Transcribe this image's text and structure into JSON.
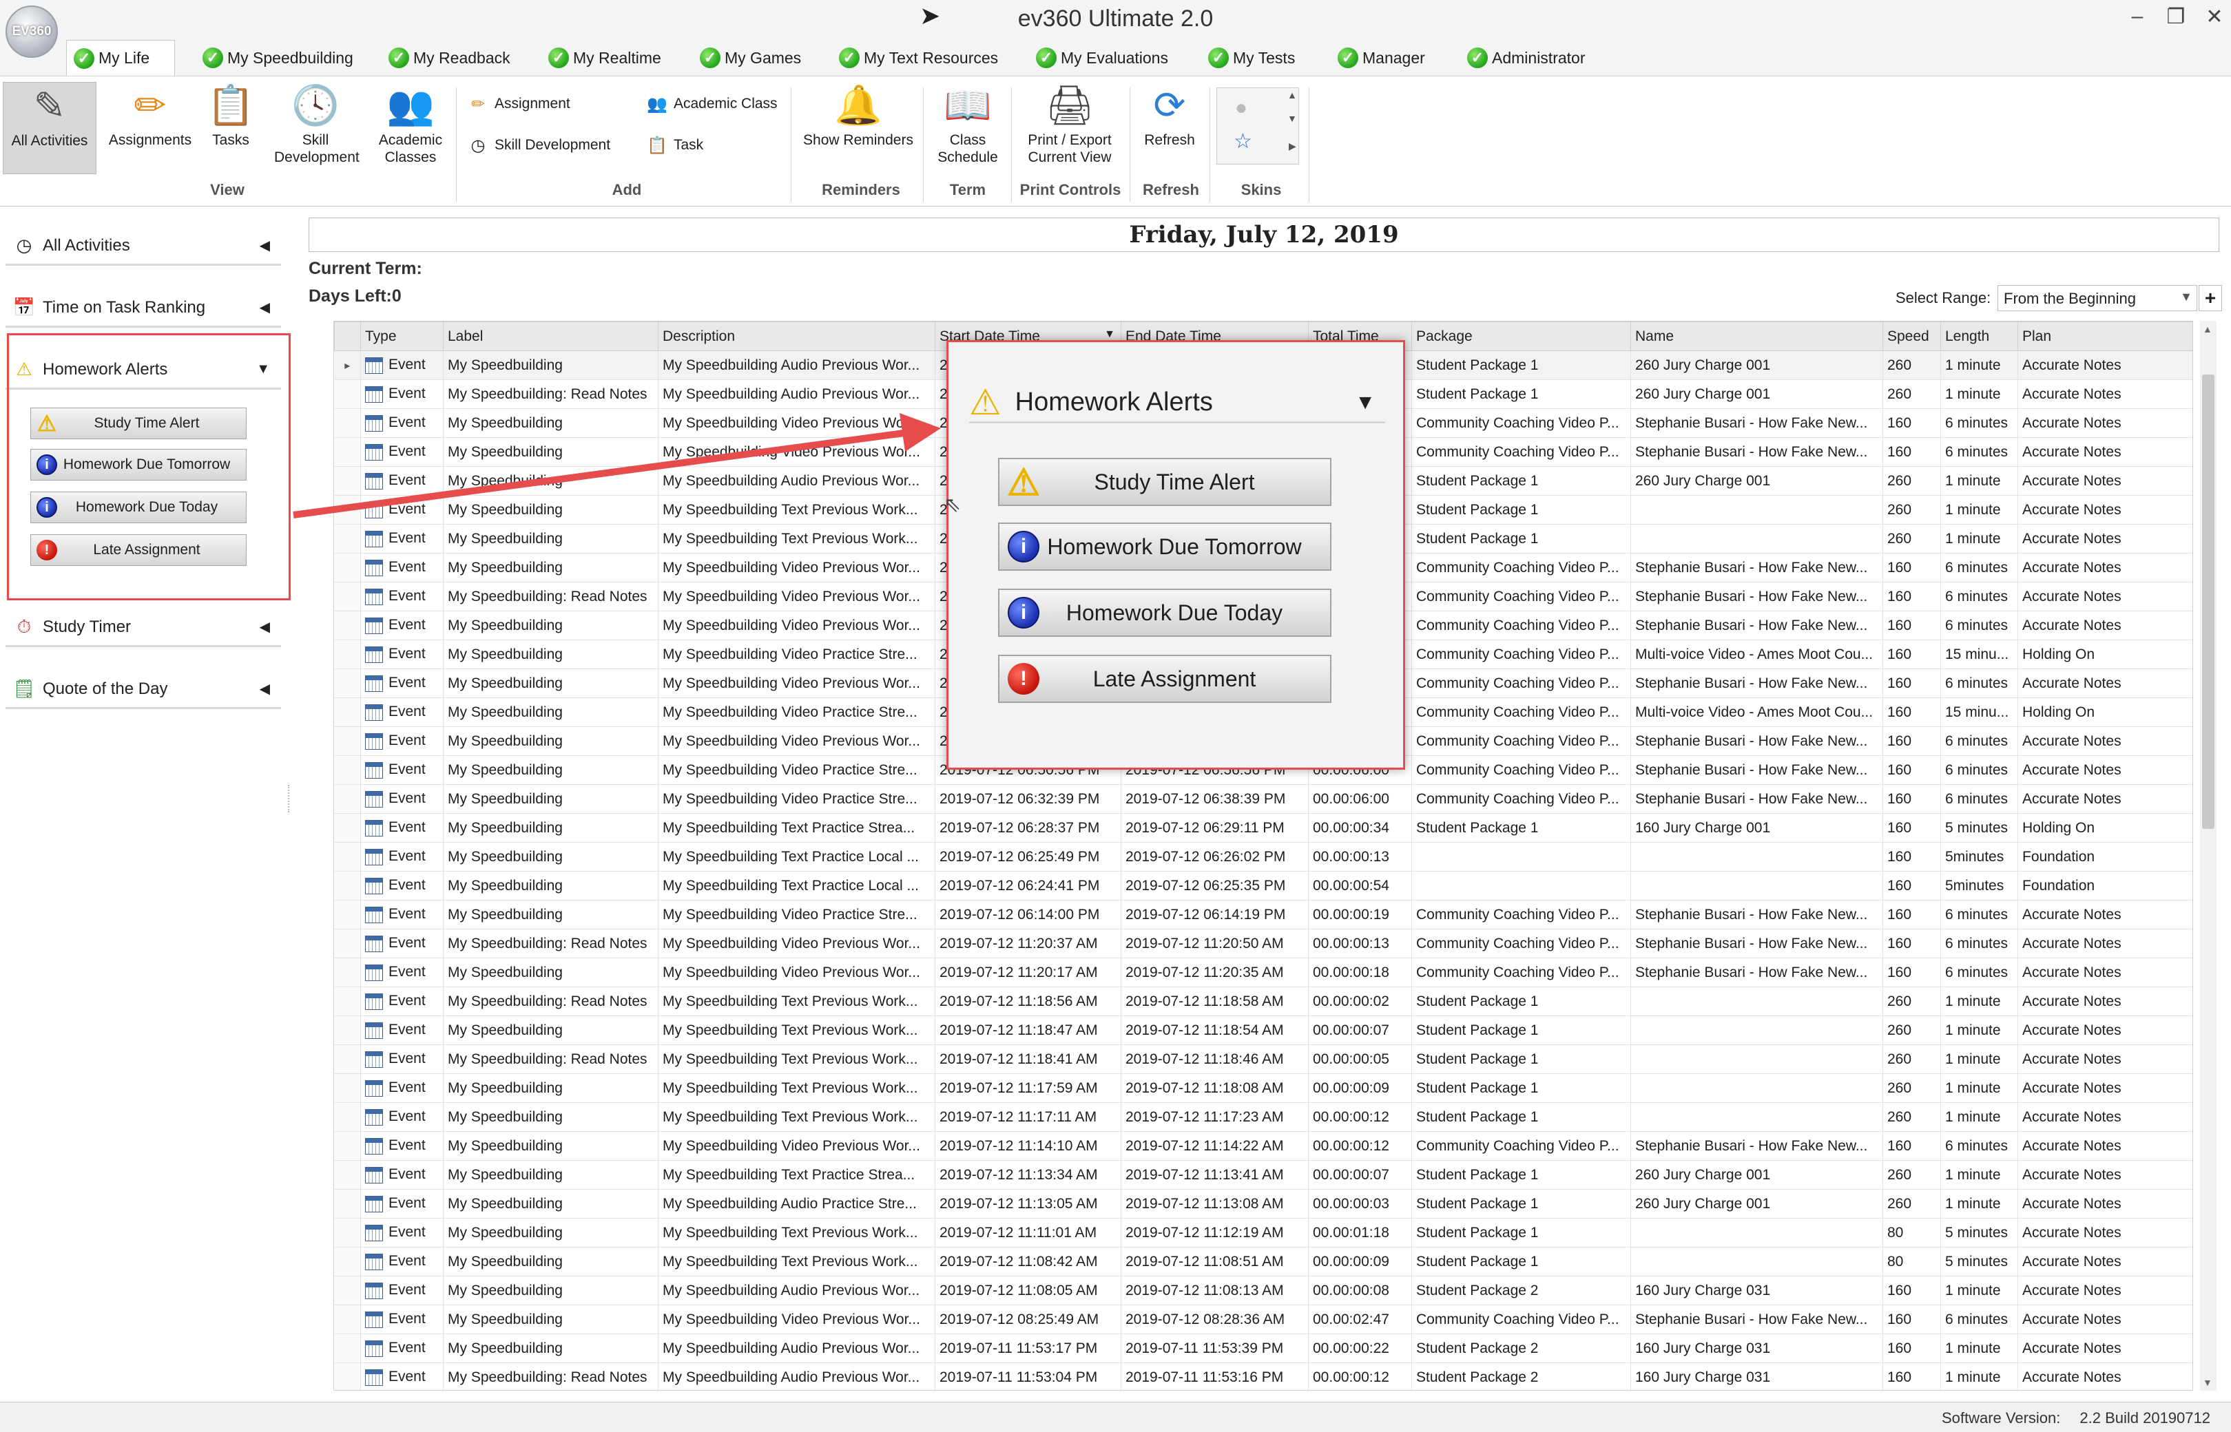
{
  "window": {
    "title": "ev360 Ultimate 2.0",
    "logo_text": "EV360",
    "minimize": "–",
    "maximize": "❐",
    "close": "✕"
  },
  "tabs": [
    {
      "label": "My Life",
      "active": true
    },
    {
      "label": "My Speedbuilding"
    },
    {
      "label": "My Readback"
    },
    {
      "label": "My Realtime"
    },
    {
      "label": "My Games"
    },
    {
      "label": "My Text Resources"
    },
    {
      "label": "My Evaluations"
    },
    {
      "label": "My Tests"
    },
    {
      "label": "Manager"
    },
    {
      "label": "Administrator"
    }
  ],
  "ribbon": {
    "view": {
      "label": "View",
      "all_activities": "All Activities",
      "assignments": "Assignments",
      "tasks": "Tasks",
      "skill_development": "Skill Development",
      "academic_classes": "Academic Classes"
    },
    "add": {
      "label": "Add",
      "assignment": "Assignment",
      "skill_development": "Skill Development",
      "academic_class": "Academic Class",
      "task": "Task"
    },
    "reminders": {
      "label": "Reminders",
      "show_reminders": "Show Reminders"
    },
    "term": {
      "label": "Term",
      "class_schedule": "Class Schedule"
    },
    "print_controls": {
      "label": "Print Controls",
      "print_export": "Print / Export Current View"
    },
    "refresh": {
      "label": "Refresh",
      "refresh": "Refresh"
    },
    "skins": {
      "label": "Skins"
    }
  },
  "sidebar": {
    "all_activities": "All Activities",
    "time_on_task": "Time on Task Ranking",
    "homework_alerts": "Homework Alerts",
    "study_timer": "Study Timer",
    "quote_of_day": "Quote of the Day",
    "alerts": {
      "study_time": "Study Time Alert",
      "due_tomorrow": "Homework Due Tomorrow",
      "due_today": "Homework Due Today",
      "late": "Late Assignment"
    }
  },
  "main": {
    "date": "Friday, July 12, 2019",
    "current_term_label": "Current Term:",
    "days_left_label": "Days Left:0",
    "select_range_label": "Select Range:",
    "select_range_value": "From the Beginning"
  },
  "grid": {
    "columns": [
      "Type",
      "Label",
      "Description",
      "Start Date Time",
      "End Date Time",
      "Total Time",
      "Package",
      "Name",
      "Speed",
      "Length",
      "Plan"
    ],
    "rows": [
      [
        "Event",
        "My Speedbuilding",
        "My Speedbuilding Audio Previous Wor...",
        "2019",
        "",
        "",
        "Student Package 1",
        "260 Jury Charge 001",
        "260",
        "1 minute",
        "Accurate Notes"
      ],
      [
        "Event",
        "My Speedbuilding: Read Notes",
        "My Speedbuilding Audio Previous Wor...",
        "2019",
        "",
        "",
        "Student Package 1",
        "260 Jury Charge 001",
        "260",
        "1 minute",
        "Accurate Notes"
      ],
      [
        "Event",
        "My Speedbuilding",
        "My Speedbuilding Video Previous Wor...",
        "2019",
        "",
        "",
        "Community Coaching Video P...",
        "Stephanie Busari - How Fake New...",
        "160",
        "6 minutes",
        "Accurate Notes"
      ],
      [
        "Event",
        "My Speedbuilding",
        "My Speedbuilding Video Previous Wor...",
        "2019",
        "",
        "",
        "Community Coaching Video P...",
        "Stephanie Busari - How Fake New...",
        "160",
        "6 minutes",
        "Accurate Notes"
      ],
      [
        "Event",
        "My Speedbuilding",
        "My Speedbuilding Audio Previous Wor...",
        "2019",
        "",
        "",
        "Student Package 1",
        "260 Jury Charge 001",
        "260",
        "1 minute",
        "Accurate Notes"
      ],
      [
        "Event",
        "My Speedbuilding",
        "My Speedbuilding Text Previous Work...",
        "2019",
        "",
        "",
        "Student Package 1",
        "",
        "260",
        "1 minute",
        "Accurate Notes"
      ],
      [
        "Event",
        "My Speedbuilding",
        "My Speedbuilding Text Previous Work...",
        "2019",
        "",
        "",
        "Student Package 1",
        "",
        "260",
        "1 minute",
        "Accurate Notes"
      ],
      [
        "Event",
        "My Speedbuilding",
        "My Speedbuilding Video Previous Wor...",
        "2019",
        "",
        "",
        "Community Coaching Video P...",
        "Stephanie Busari - How Fake New...",
        "160",
        "6 minutes",
        "Accurate Notes"
      ],
      [
        "Event",
        "My Speedbuilding: Read Notes",
        "My Speedbuilding Video Previous Wor...",
        "2019",
        "",
        "",
        "Community Coaching Video P...",
        "Stephanie Busari - How Fake New...",
        "160",
        "6 minutes",
        "Accurate Notes"
      ],
      [
        "Event",
        "My Speedbuilding",
        "My Speedbuilding Video Previous Wor...",
        "2019",
        "",
        "",
        "Community Coaching Video P...",
        "Stephanie Busari - How Fake New...",
        "160",
        "6 minutes",
        "Accurate Notes"
      ],
      [
        "Event",
        "My Speedbuilding",
        "My Speedbuilding Video Practice Stre...",
        "2019",
        "",
        "",
        "Community Coaching Video P...",
        "Multi-voice Video - Ames Moot Cou...",
        "160",
        "15 minu...",
        "Holding On"
      ],
      [
        "Event",
        "My Speedbuilding",
        "My Speedbuilding Video Previous Wor...",
        "2019",
        "",
        "",
        "Community Coaching Video P...",
        "Stephanie Busari - How Fake New...",
        "160",
        "6 minutes",
        "Accurate Notes"
      ],
      [
        "Event",
        "My Speedbuilding",
        "My Speedbuilding Video Practice Stre...",
        "2019",
        "",
        "",
        "Community Coaching Video P...",
        "Multi-voice Video - Ames Moot Cou...",
        "160",
        "15 minu...",
        "Holding On"
      ],
      [
        "Event",
        "My Speedbuilding",
        "My Speedbuilding Video Previous Wor...",
        "2019",
        "",
        "",
        "Community Coaching Video P...",
        "Stephanie Busari - How Fake New...",
        "160",
        "6 minutes",
        "Accurate Notes"
      ],
      [
        "Event",
        "My Speedbuilding",
        "My Speedbuilding Video Practice Stre...",
        "2019-07-12 06:50:56 PM",
        "2019-07-12 06:56:56 PM",
        "00.00:06:00",
        "Community Coaching Video P...",
        "Stephanie Busari - How Fake New...",
        "160",
        "6 minutes",
        "Accurate Notes"
      ],
      [
        "Event",
        "My Speedbuilding",
        "My Speedbuilding Video Practice Stre...",
        "2019-07-12 06:32:39 PM",
        "2019-07-12 06:38:39 PM",
        "00.00:06:00",
        "Community Coaching Video P...",
        "Stephanie Busari - How Fake New...",
        "160",
        "6 minutes",
        "Accurate Notes"
      ],
      [
        "Event",
        "My Speedbuilding",
        "My Speedbuilding Text Practice Strea...",
        "2019-07-12 06:28:37 PM",
        "2019-07-12 06:29:11 PM",
        "00.00:00:34",
        "Student Package 1",
        "160 Jury Charge 001",
        "160",
        "5 minutes",
        "Holding On"
      ],
      [
        "Event",
        "My Speedbuilding",
        "My Speedbuilding Text Practice Local ...",
        "2019-07-12 06:25:49 PM",
        "2019-07-12 06:26:02 PM",
        "00.00:00:13",
        "",
        "",
        "160",
        "5minutes",
        "Foundation"
      ],
      [
        "Event",
        "My Speedbuilding",
        "My Speedbuilding Text Practice Local ...",
        "2019-07-12 06:24:41 PM",
        "2019-07-12 06:25:35 PM",
        "00.00:00:54",
        "",
        "",
        "160",
        "5minutes",
        "Foundation"
      ],
      [
        "Event",
        "My Speedbuilding",
        "My Speedbuilding Video Practice Stre...",
        "2019-07-12 06:14:00 PM",
        "2019-07-12 06:14:19 PM",
        "00.00:00:19",
        "Community Coaching Video P...",
        "Stephanie Busari - How Fake New...",
        "160",
        "6 minutes",
        "Accurate Notes"
      ],
      [
        "Event",
        "My Speedbuilding: Read Notes",
        "My Speedbuilding Video Previous Wor...",
        "2019-07-12 11:20:37 AM",
        "2019-07-12 11:20:50 AM",
        "00.00:00:13",
        "Community Coaching Video P...",
        "Stephanie Busari - How Fake New...",
        "160",
        "6 minutes",
        "Accurate Notes"
      ],
      [
        "Event",
        "My Speedbuilding",
        "My Speedbuilding Video Previous Wor...",
        "2019-07-12 11:20:17 AM",
        "2019-07-12 11:20:35 AM",
        "00.00:00:18",
        "Community Coaching Video P...",
        "Stephanie Busari - How Fake New...",
        "160",
        "6 minutes",
        "Accurate Notes"
      ],
      [
        "Event",
        "My Speedbuilding: Read Notes",
        "My Speedbuilding Text Previous Work...",
        "2019-07-12 11:18:56 AM",
        "2019-07-12 11:18:58 AM",
        "00.00:00:02",
        "Student Package 1",
        "",
        "260",
        "1 minute",
        "Accurate Notes"
      ],
      [
        "Event",
        "My Speedbuilding",
        "My Speedbuilding Text Previous Work...",
        "2019-07-12 11:18:47 AM",
        "2019-07-12 11:18:54 AM",
        "00.00:00:07",
        "Student Package 1",
        "",
        "260",
        "1 minute",
        "Accurate Notes"
      ],
      [
        "Event",
        "My Speedbuilding: Read Notes",
        "My Speedbuilding Text Previous Work...",
        "2019-07-12 11:18:41 AM",
        "2019-07-12 11:18:46 AM",
        "00.00:00:05",
        "Student Package 1",
        "",
        "260",
        "1 minute",
        "Accurate Notes"
      ],
      [
        "Event",
        "My Speedbuilding",
        "My Speedbuilding Text Previous Work...",
        "2019-07-12 11:17:59 AM",
        "2019-07-12 11:18:08 AM",
        "00.00:00:09",
        "Student Package 1",
        "",
        "260",
        "1 minute",
        "Accurate Notes"
      ],
      [
        "Event",
        "My Speedbuilding",
        "My Speedbuilding Text Previous Work...",
        "2019-07-12 11:17:11 AM",
        "2019-07-12 11:17:23 AM",
        "00.00:00:12",
        "Student Package 1",
        "",
        "260",
        "1 minute",
        "Accurate Notes"
      ],
      [
        "Event",
        "My Speedbuilding",
        "My Speedbuilding Video Previous Wor...",
        "2019-07-12 11:14:10 AM",
        "2019-07-12 11:14:22 AM",
        "00.00:00:12",
        "Community Coaching Video P...",
        "Stephanie Busari - How Fake New...",
        "160",
        "6 minutes",
        "Accurate Notes"
      ],
      [
        "Event",
        "My Speedbuilding",
        "My Speedbuilding Text Practice Strea...",
        "2019-07-12 11:13:34 AM",
        "2019-07-12 11:13:41 AM",
        "00.00:00:07",
        "Student Package 1",
        "260 Jury Charge 001",
        "260",
        "1 minute",
        "Accurate Notes"
      ],
      [
        "Event",
        "My Speedbuilding",
        "My Speedbuilding Audio Practice Stre...",
        "2019-07-12 11:13:05 AM",
        "2019-07-12 11:13:08 AM",
        "00.00:00:03",
        "Student Package 1",
        "260 Jury Charge 001",
        "260",
        "1 minute",
        "Accurate Notes"
      ],
      [
        "Event",
        "My Speedbuilding",
        "My Speedbuilding Text Previous Work...",
        "2019-07-12 11:11:01 AM",
        "2019-07-12 11:12:19 AM",
        "00.00:01:18",
        "Student Package 1",
        "",
        "80",
        "5 minutes",
        "Accurate Notes"
      ],
      [
        "Event",
        "My Speedbuilding",
        "My Speedbuilding Text Previous Work...",
        "2019-07-12 11:08:42 AM",
        "2019-07-12 11:08:51 AM",
        "00.00:00:09",
        "Student Package 1",
        "",
        "80",
        "5 minutes",
        "Accurate Notes"
      ],
      [
        "Event",
        "My Speedbuilding",
        "My Speedbuilding Audio Previous Wor...",
        "2019-07-12 11:08:05 AM",
        "2019-07-12 11:08:13 AM",
        "00.00:00:08",
        "Student Package 2",
        "160 Jury Charge 031",
        "160",
        "1 minute",
        "Accurate Notes"
      ],
      [
        "Event",
        "My Speedbuilding",
        "My Speedbuilding Video Previous Wor...",
        "2019-07-12 08:25:49 AM",
        "2019-07-12 08:28:36 AM",
        "00.00:02:47",
        "Community Coaching Video P...",
        "Stephanie Busari - How Fake New...",
        "160",
        "6 minutes",
        "Accurate Notes"
      ],
      [
        "Event",
        "My Speedbuilding",
        "My Speedbuilding Audio Previous Wor...",
        "2019-07-11 11:53:17 PM",
        "2019-07-11 11:53:39 PM",
        "00.00:00:22",
        "Student Package 2",
        "160 Jury Charge 031",
        "160",
        "1 minute",
        "Accurate Notes"
      ],
      [
        "Event",
        "My Speedbuilding: Read Notes",
        "My Speedbuilding Audio Previous Wor...",
        "2019-07-11 11:53:04 PM",
        "2019-07-11 11:53:16 PM",
        "00.00:00:12",
        "Student Package 2",
        "160 Jury Charge 031",
        "160",
        "1 minute",
        "Accurate Notes"
      ]
    ]
  },
  "status": {
    "label": "Software Version:",
    "value": "2.2 Build 20190712"
  },
  "colors": {
    "highlight_red": "#e74c4c",
    "check_green": "#23a51c",
    "info_blue": "#1b2fb0",
    "error_red": "#c4140b",
    "warning_yellow": "#e8b400"
  }
}
